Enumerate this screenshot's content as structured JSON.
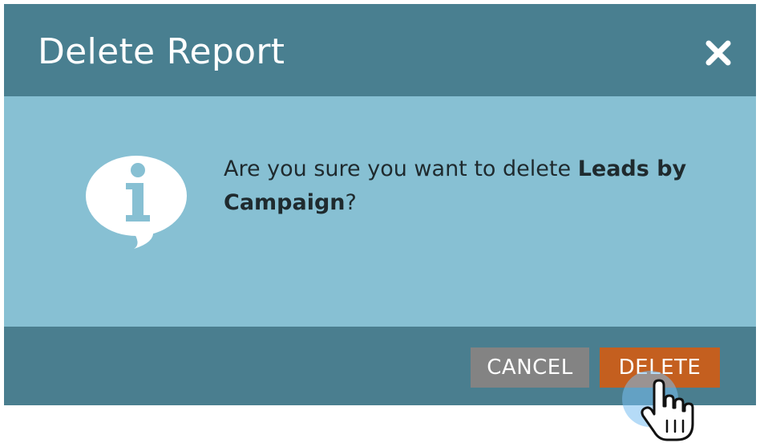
{
  "dialog": {
    "title": "Delete Report",
    "close_icon": "close-icon",
    "message_prefix": "Are you sure you want to delete ",
    "report_name": "Leads by Campaign",
    "message_suffix": "?",
    "info_icon": "info-speech-bubble-icon"
  },
  "footer": {
    "cancel_label": "CANCEL",
    "delete_label": "DELETE"
  },
  "colors": {
    "header": "#497f90",
    "body": "#87c0d3",
    "cancel_button": "#838383",
    "delete_button": "#c45f1f"
  },
  "cursor": {
    "icon": "hand-pointer-icon",
    "hovering": "delete-button"
  }
}
